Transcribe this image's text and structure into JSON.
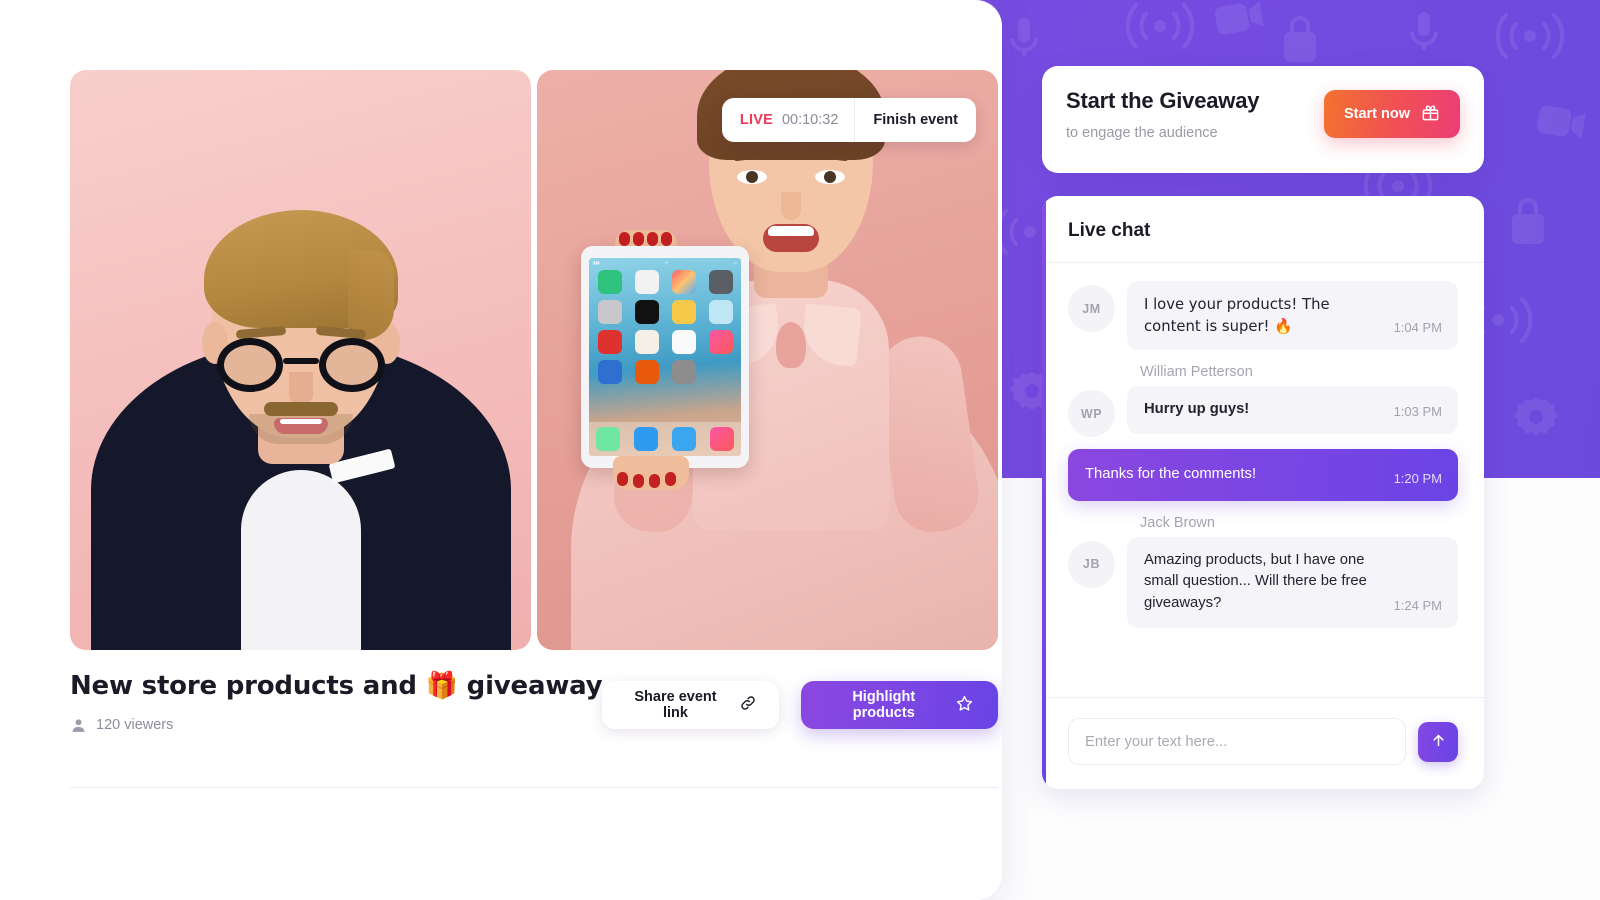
{
  "theme": {
    "purple": "#7a4ce2",
    "purple_deep": "#6d4ade",
    "accent_pink": "#ec3d76",
    "accent_orange": "#f4722f",
    "live_red": "#f0395a"
  },
  "stream": {
    "live_label": "LIVE",
    "timer": "00:10:32",
    "finish_label": "Finish event",
    "tiles": [
      {
        "name": "presenter-tile-left"
      },
      {
        "name": "presenter-tile-right"
      }
    ]
  },
  "event": {
    "title": "New store products and 🎁 giveaway",
    "viewers": "120 viewers",
    "share_label": "Share event link",
    "share_icon": "link-icon",
    "highlight_label": "Highlight products",
    "highlight_icon": "star-icon"
  },
  "giveaway": {
    "title": "Start the Giveaway",
    "subtitle": "to engage the audience",
    "button_label": "Start now",
    "button_icon": "gift-icon"
  },
  "chat": {
    "header": "Live chat",
    "messages": [
      {
        "initials": "JM",
        "sender": "",
        "text": "I love your products! The content is super! 🔥",
        "time": "1:04 PM",
        "own": false
      },
      {
        "initials": "WP",
        "sender": "William Petterson",
        "text": "Hurry up guys!",
        "time": "1:03 PM",
        "own": false
      },
      {
        "initials": "",
        "sender": "",
        "text": "Thanks for the comments!",
        "time": "1:20 PM",
        "own": true
      },
      {
        "initials": "JB",
        "sender": "Jack Brown",
        "text": "Amazing products, but I have one small question... Will there be free giveaways?",
        "time": "1:24 PM",
        "own": false
      }
    ],
    "input_placeholder": "Enter your text here...",
    "input_value": "",
    "send_icon": "arrow-up-icon"
  }
}
